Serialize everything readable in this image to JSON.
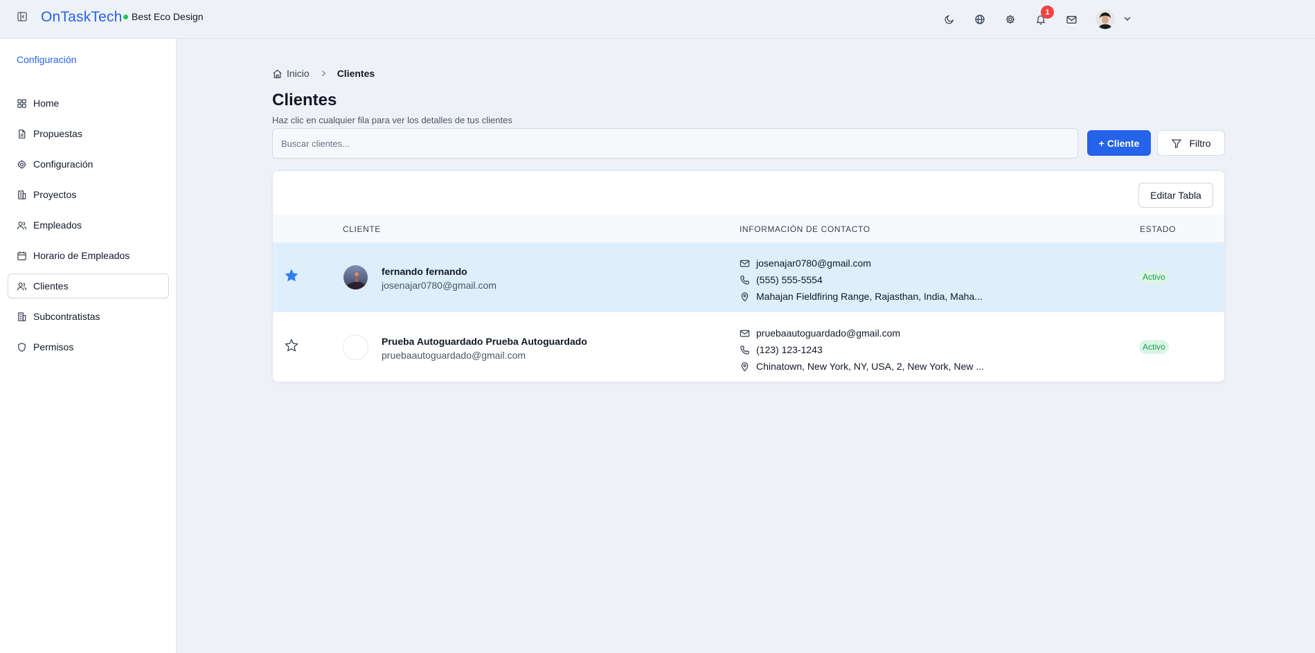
{
  "header": {
    "brand": "OnTaskTech",
    "company": "Best Eco Design",
    "notification_count": "1",
    "icons": [
      "sidebar-toggle-icon",
      "moon-icon",
      "globe-icon",
      "gear-icon",
      "bell-icon",
      "mail-icon",
      "avatar",
      "chevron-down-icon"
    ]
  },
  "sidebar": {
    "heading": "Configuración",
    "items": [
      {
        "label": "Home",
        "icon": "grid-icon"
      },
      {
        "label": "Propuestas",
        "icon": "document-icon"
      },
      {
        "label": "Configuración",
        "icon": "gear-icon"
      },
      {
        "label": "Proyectos",
        "icon": "building-icon"
      },
      {
        "label": "Empleados",
        "icon": "users-icon"
      },
      {
        "label": "Horario de Empleados",
        "icon": "calendar-icon"
      },
      {
        "label": "Clientes",
        "icon": "users-icon",
        "active": true
      },
      {
        "label": "Subcontratistas",
        "icon": "building-icon"
      },
      {
        "label": "Permisos",
        "icon": "shield-icon"
      }
    ]
  },
  "breadcrumb": {
    "home": "Inicio",
    "current": "Clientes"
  },
  "page": {
    "title": "Clientes",
    "subtitle": "Haz clic en cualquier fila para ver los detalles de tus clientes",
    "search_placeholder": "Buscar clientes...",
    "add_button": "+ Cliente",
    "filter_button": "Filtro",
    "edit_table_button": "Editar Tabla"
  },
  "table": {
    "columns": [
      "CLIENTE",
      "INFORMACIÓN DE CONTACTO",
      "ESTADO"
    ],
    "rows": [
      {
        "starred": true,
        "name": "fernando fernando",
        "email": "josenajar0780@gmail.com",
        "contact_email": "josenajar0780@gmail.com",
        "phone": "(555) 555-5554",
        "address": "Mahajan Fieldfiring Range, Rajasthan, India, Maha...",
        "status": "Activo"
      },
      {
        "starred": false,
        "name": "Prueba Autoguardado Prueba Autoguardado",
        "email": "pruebaautoguardado@gmail.com",
        "contact_email": "pruebaautoguardado@gmail.com",
        "phone": "(123) 123-1243",
        "address": "Chinatown, New York, NY, USA, 2, New York, New ...",
        "status": "Activo"
      }
    ]
  },
  "colors": {
    "accent": "#2563eb",
    "selected_row": "#dfeefb",
    "status_bg": "#dcf5e6",
    "status_text": "#16a34a",
    "badge": "#ef4444",
    "online_dot": "#22c55e"
  }
}
